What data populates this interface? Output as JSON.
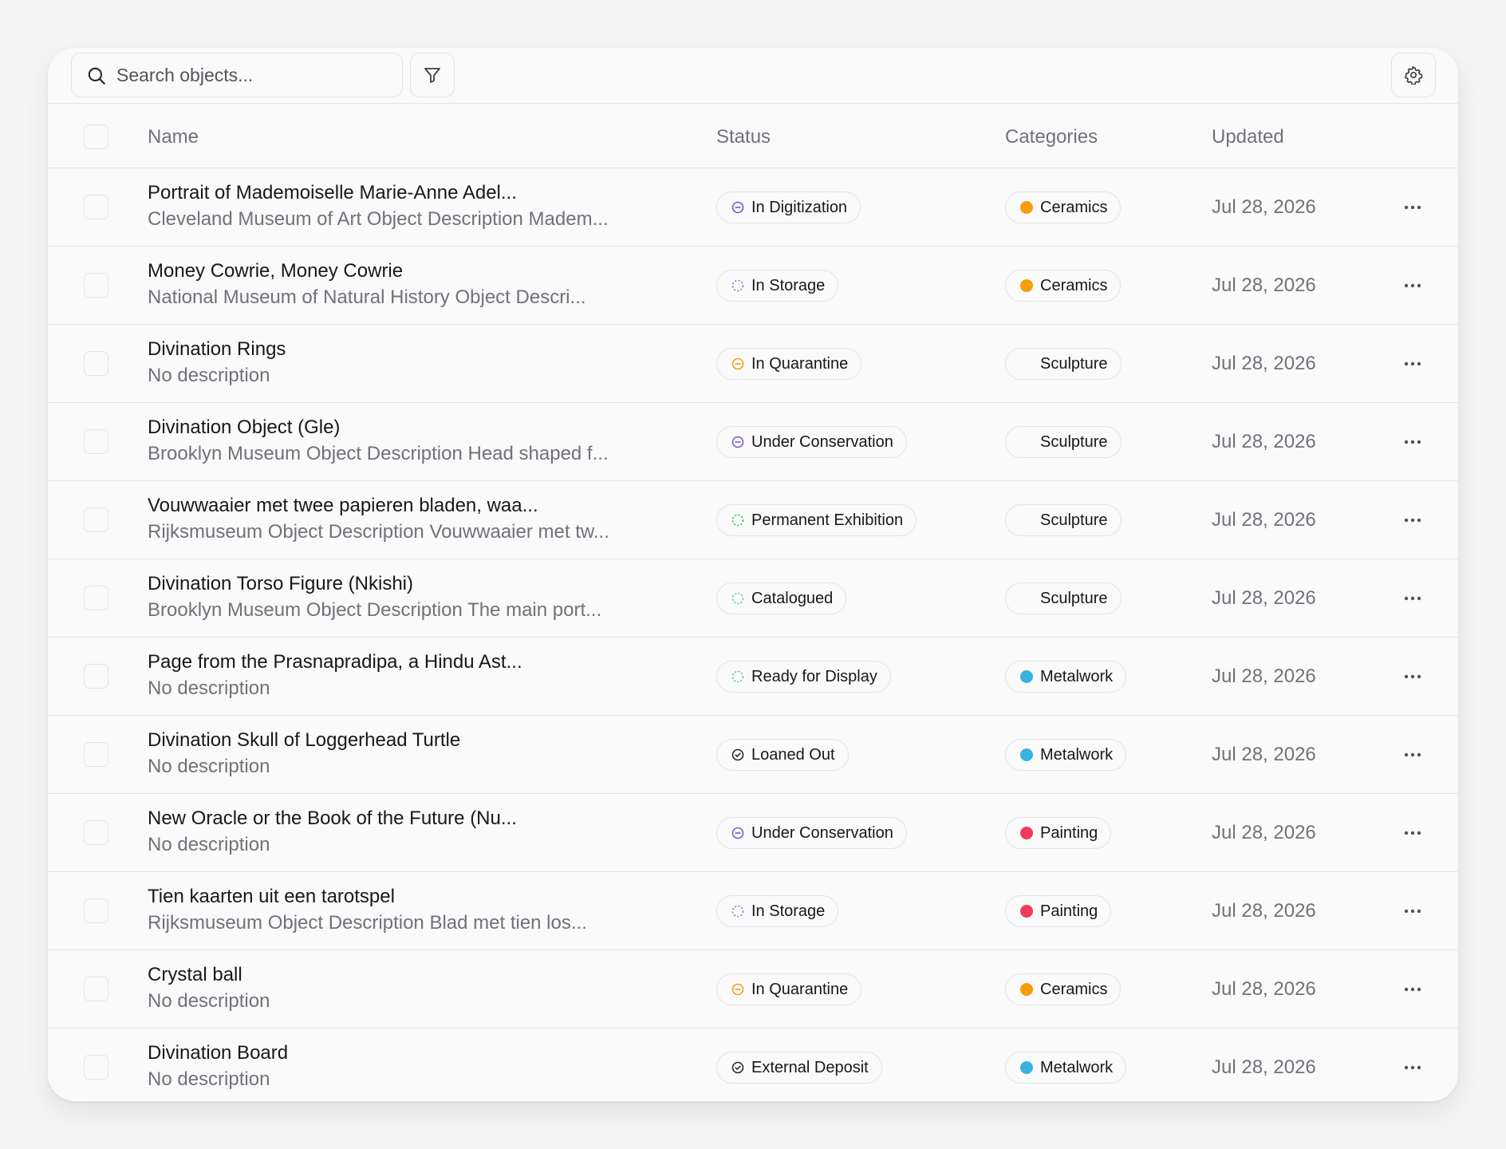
{
  "toolbar": {
    "search_placeholder": "Search objects...",
    "icons": {
      "search": "search-icon",
      "filter": "filter-icon",
      "settings": "gear-icon"
    }
  },
  "table": {
    "columns": {
      "name": "Name",
      "status": "Status",
      "categories": "Categories",
      "updated": "Updated"
    },
    "rows": [
      {
        "name": "Portrait of Mademoiselle Marie-Anne Adel...",
        "description": "Cleveland Museum of Art Object Description Madem...",
        "status": "In Digitization",
        "status_kind": "minus",
        "status_color": "#6d5bd0",
        "category": "Ceramics",
        "category_color": "#f59e0b",
        "updated": "Jul 28, 2026"
      },
      {
        "name": "Money Cowrie, Money Cowrie",
        "description": "National Museum of Natural History Object Descri...",
        "status": "In Storage",
        "status_kind": "dashed",
        "status_color": "#6d8fd6",
        "category": "Ceramics",
        "category_color": "#f59e0b",
        "updated": "Jul 28, 2026"
      },
      {
        "name": "Divination Rings",
        "description": "No description",
        "status": "In Quarantine",
        "status_kind": "minus",
        "status_color": "#f59e0b",
        "category": "Sculpture",
        "category_color": "",
        "updated": "Jul 28, 2026"
      },
      {
        "name": "Divination Object (Gle)",
        "description": "Brooklyn Museum Object Description Head shaped f...",
        "status": "Under Conservation",
        "status_kind": "minus",
        "status_color": "#7c5ad6",
        "category": "Sculpture",
        "category_color": "",
        "updated": "Jul 28, 2026"
      },
      {
        "name": "Vouwwaaier met twee papieren bladen, waa...",
        "description": "Rijksmuseum Object Description Vouwwaaier met tw...",
        "status": "Permanent Exhibition",
        "status_kind": "dashed",
        "status_color": "#22c55e",
        "category": "Sculpture",
        "category_color": "",
        "updated": "Jul 28, 2026"
      },
      {
        "name": "Divination Torso Figure (Nkishi)",
        "description": "Brooklyn Museum Object Description The main port...",
        "status": "Catalogued",
        "status_kind": "dashed",
        "status_color": "#5ec4c4",
        "category": "Sculpture",
        "category_color": "",
        "updated": "Jul 28, 2026"
      },
      {
        "name": "Page from the Prasnapradipa, a Hindu Ast...",
        "description": "No description",
        "status": "Ready for Display",
        "status_kind": "dashed",
        "status_color": "#6cc58a",
        "category": "Metalwork",
        "category_color": "#38b2e0",
        "updated": "Jul 28, 2026"
      },
      {
        "name": "Divination Skull of Loggerhead Turtle",
        "description": "No description",
        "status": "Loaned Out",
        "status_kind": "check",
        "status_color": "#27272a",
        "category": "Metalwork",
        "category_color": "#38b2e0",
        "updated": "Jul 28, 2026"
      },
      {
        "name": "New Oracle or the Book of the Future (Nu...",
        "description": "No description",
        "status": "Under Conservation",
        "status_kind": "minus",
        "status_color": "#7c5ad6",
        "category": "Painting",
        "category_color": "#ef3b5a",
        "updated": "Jul 28, 2026"
      },
      {
        "name": "Tien kaarten uit een tarotspel",
        "description": "Rijksmuseum Object Description Blad met tien los...",
        "status": "In Storage",
        "status_kind": "dashed",
        "status_color": "#6d8fd6",
        "category": "Painting",
        "category_color": "#ef3b5a",
        "updated": "Jul 28, 2026"
      },
      {
        "name": "Crystal ball",
        "description": "No description",
        "status": "In Quarantine",
        "status_kind": "minus",
        "status_color": "#f59e0b",
        "category": "Ceramics",
        "category_color": "#f59e0b",
        "updated": "Jul 28, 2026"
      },
      {
        "name": "Divination Board",
        "description": "No description",
        "status": "External Deposit",
        "status_kind": "check",
        "status_color": "#27272a",
        "category": "Metalwork",
        "category_color": "#38b2e0",
        "updated": "Jul 28, 2026"
      }
    ]
  }
}
